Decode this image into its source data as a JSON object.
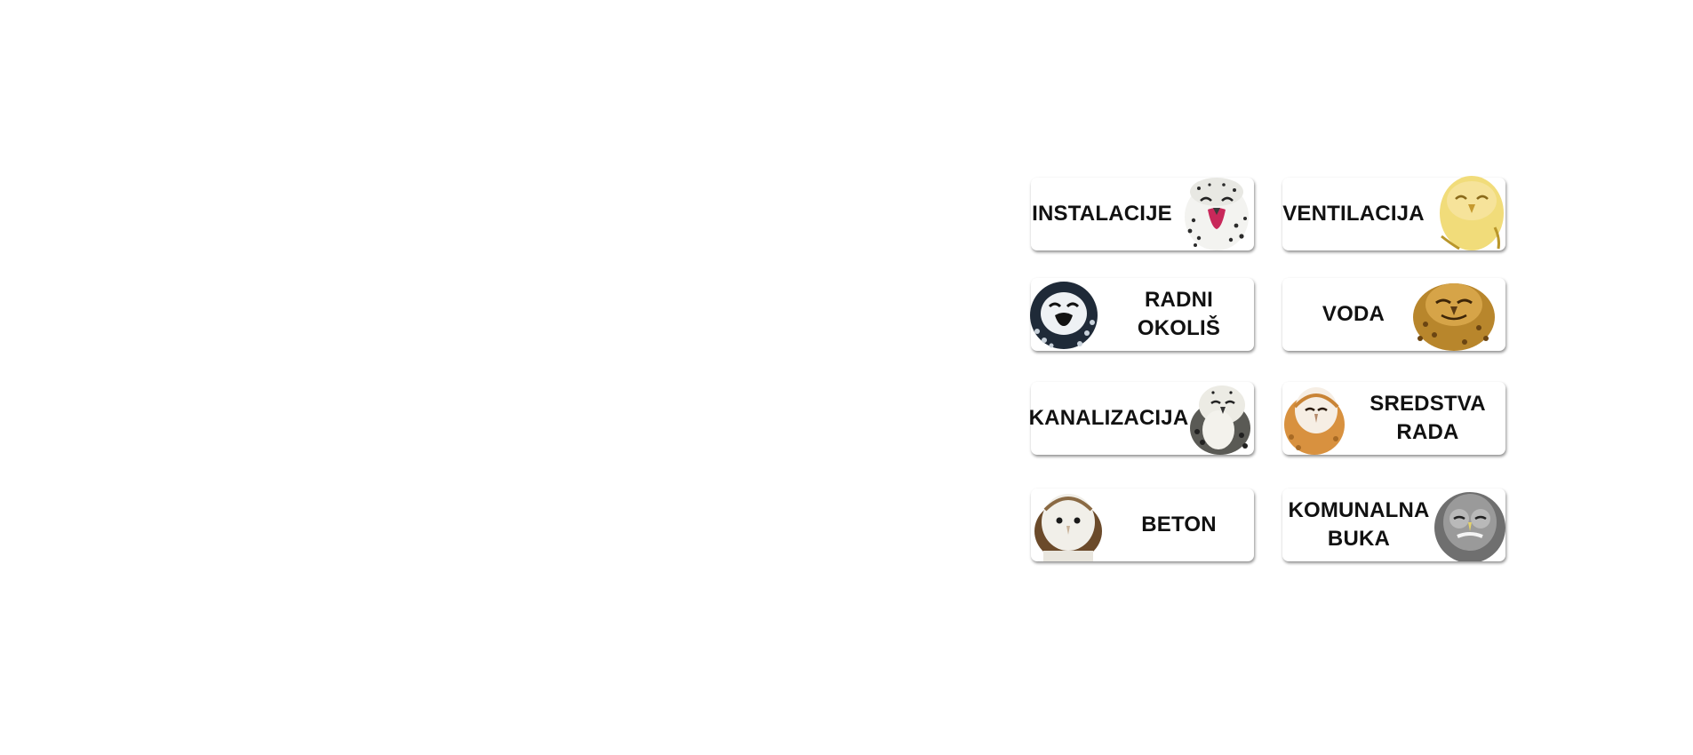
{
  "cards": [
    {
      "label": "INSTALACIJE"
    },
    {
      "label": "VENTILACIJA"
    },
    {
      "label_line1": "RADNI",
      "label_line2": "OKOLIŠ"
    },
    {
      "label": "VODA"
    },
    {
      "label": "KANALIZACIJA"
    },
    {
      "label_line1": "SREDSTVA",
      "label_line2": "RADA"
    },
    {
      "label": "BETON"
    },
    {
      "label_line1": "KOMUNALNA",
      "label_line2": "BUKA"
    }
  ],
  "icons": [
    "snowy-owl-laughing-icon",
    "yellow-owl-laughing-icon",
    "black-white-owl-laughing-icon",
    "brown-owl-smiling-icon",
    "snowy-owl-sitting-icon",
    "barn-owl-icon",
    "white-barn-owl-icon",
    "grey-owl-icon"
  ]
}
